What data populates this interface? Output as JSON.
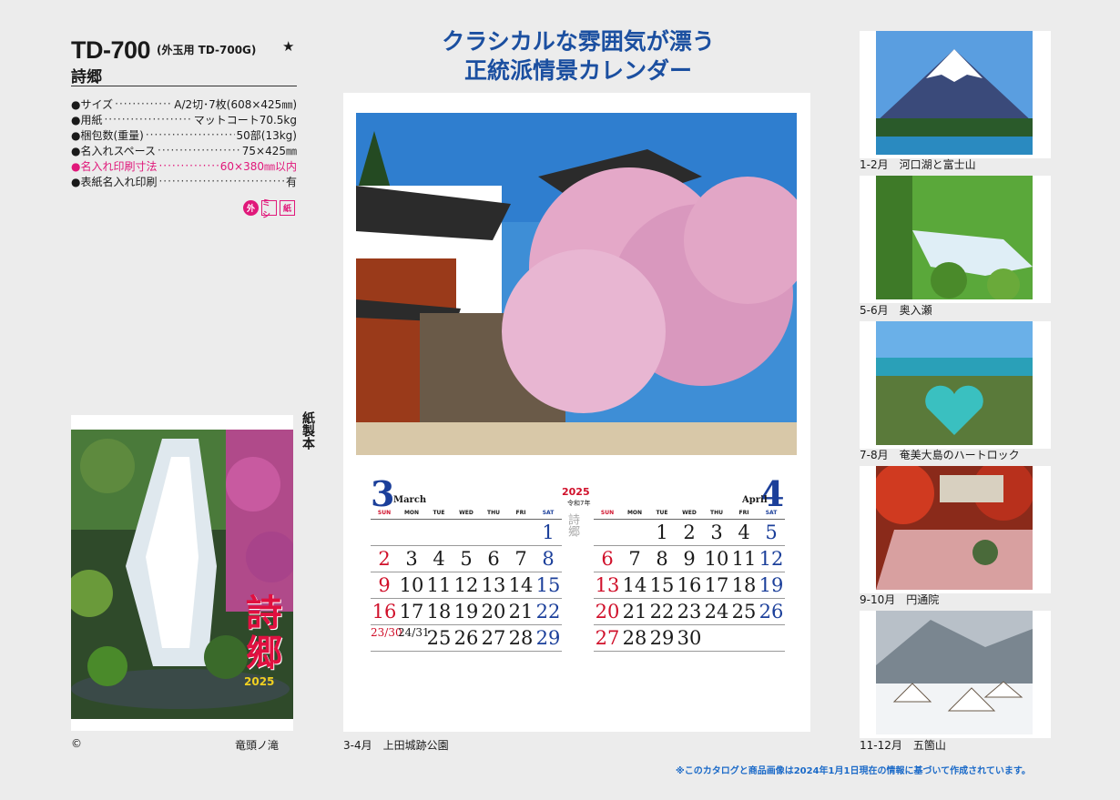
{
  "product": {
    "code": "TD-700",
    "code_sub": "(外玉用 TD-700G)",
    "star": "★",
    "name": "詩郷"
  },
  "specs": [
    {
      "label": "●サイズ",
      "value": "A/2切･7枚(608×425㎜)",
      "highlight": false
    },
    {
      "label": "●用紙",
      "value": "マットコート70.5kg",
      "highlight": false
    },
    {
      "label": "●梱包数(重量)",
      "value": "50部(13kg)",
      "highlight": false
    },
    {
      "label": "●名入れスペース",
      "value": "75×425㎜",
      "highlight": false
    },
    {
      "label": "●名入れ印刷寸法",
      "value": "60×380㎜以内",
      "highlight": true
    },
    {
      "label": "●表紙名入れ印刷",
      "value": "有",
      "highlight": false
    }
  ],
  "tags": [
    "外",
    "ミシ",
    "紙"
  ],
  "cover": {
    "title": "詩郷",
    "year": "2025",
    "binding": "紙製本",
    "copyright": "©",
    "caption": "竜頭ノ滝"
  },
  "headline": {
    "line1": "クラシカルな雰囲気が漂う",
    "line2": "正統派情景カレンダー"
  },
  "main_calendar": {
    "caption": "3-4月　上田城跡公園",
    "year": "2025",
    "reiwa": "令和7年",
    "stamp": "詩郷",
    "weekdays": [
      "SUN",
      "MON",
      "TUE",
      "WED",
      "THU",
      "FRI",
      "SAT"
    ],
    "month1": {
      "number": "3",
      "name": "March",
      "cells": [
        "",
        "",
        "",
        "",
        "",
        "",
        "1",
        "2",
        "3",
        "4",
        "5",
        "6",
        "7",
        "8",
        "9",
        "10",
        "11",
        "12",
        "13",
        "14",
        "15",
        "16",
        "17",
        "18",
        "19",
        "20",
        "21",
        "22",
        "23/30",
        "24/31",
        "25",
        "26",
        "27",
        "28",
        "29"
      ]
    },
    "month2": {
      "number": "4",
      "name": "April",
      "cells": [
        "",
        "",
        "1",
        "2",
        "3",
        "4",
        "5",
        "6",
        "7",
        "8",
        "9",
        "10",
        "11",
        "12",
        "13",
        "14",
        "15",
        "16",
        "17",
        "18",
        "19",
        "20",
        "21",
        "22",
        "23",
        "24",
        "25",
        "26",
        "27",
        "28",
        "29",
        "30",
        "",
        "",
        ""
      ]
    }
  },
  "thumbnails": [
    {
      "caption": "1-2月　河口湖と富士山",
      "icon": "mount-fuji-photo"
    },
    {
      "caption": "5-6月　奥入瀬",
      "icon": "mountain-stream-photo"
    },
    {
      "caption": "7-8月　奄美大島のハートロック",
      "icon": "heart-rock-photo"
    },
    {
      "caption": "9-10月　円通院",
      "icon": "temple-garden-photo"
    },
    {
      "caption": "11-12月　五箇山",
      "icon": "snow-village-photo"
    }
  ],
  "footnote": "※このカタログと商品画像は2024年1月1日現在の情報に基づいて作成されています。",
  "colors": {
    "accent": "#1b4fa0",
    "pink": "#e0187a",
    "sunday": "#d0102a",
    "saturday": "#1b3f9a"
  }
}
